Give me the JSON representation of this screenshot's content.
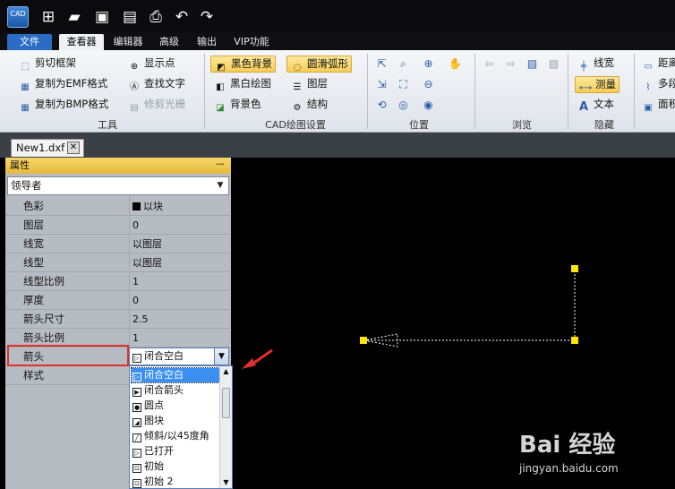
{
  "app": {
    "logo_text": "CAD"
  },
  "menu": {
    "tabs": [
      "文件",
      "查看器",
      "编辑器",
      "高级",
      "输出",
      "VIP功能"
    ],
    "active_tab": "查看器"
  },
  "ribbon": {
    "tools": {
      "items": [
        "剪切框架",
        "复制为EMF格式",
        "复制为BMP格式",
        "显示点",
        "查找文字",
        "修剪光栅"
      ],
      "label": "工具"
    },
    "cad_settings": {
      "items": [
        "黑色背景",
        "圆滑弧形",
        "黑白绘图",
        "图层",
        "背景色",
        "结构"
      ],
      "label": "CAD绘图设置"
    },
    "position": {
      "label": "位置"
    },
    "browse": {
      "label": "浏览"
    },
    "hide": {
      "items": [
        "线宽",
        "测量",
        "文本"
      ],
      "label": "隐藏"
    },
    "extra": {
      "items": [
        "距离",
        "多段",
        "面积"
      ]
    }
  },
  "document": {
    "tab_name": "New1.dxf",
    "close_symbol": "✕"
  },
  "properties": {
    "title": "属性",
    "pin": "ꟷ",
    "selector_value": "领导者",
    "rows": [
      {
        "name": "色彩",
        "value": "以块"
      },
      {
        "name": "图层",
        "value": "0"
      },
      {
        "name": "线宽",
        "value": "以图层"
      },
      {
        "name": "线型",
        "value": "以图层"
      },
      {
        "name": "线型比例",
        "value": "1"
      },
      {
        "name": "厚度",
        "value": "0"
      },
      {
        "name": "箭头尺寸",
        "value": "2.5"
      },
      {
        "name": "箭头比例",
        "value": "1"
      },
      {
        "name": "箭头",
        "value": "闭合空白"
      },
      {
        "name": "样式",
        "value": ""
      }
    ],
    "arrow_dropdown": {
      "options": [
        "闭合空白",
        "闭合箭头",
        "圆点",
        "图块",
        "倾斜/以45度角",
        "已打开",
        "初始",
        "初始 2"
      ],
      "selected_index": 0
    }
  },
  "watermark": {
    "text": "Bai 经验",
    "url": "jingyan.baidu.com"
  },
  "colors": {
    "accent": "#e0302b",
    "highlight": "#f7cd55",
    "selection": "#3b8ff0",
    "handle": "#ffe600"
  }
}
